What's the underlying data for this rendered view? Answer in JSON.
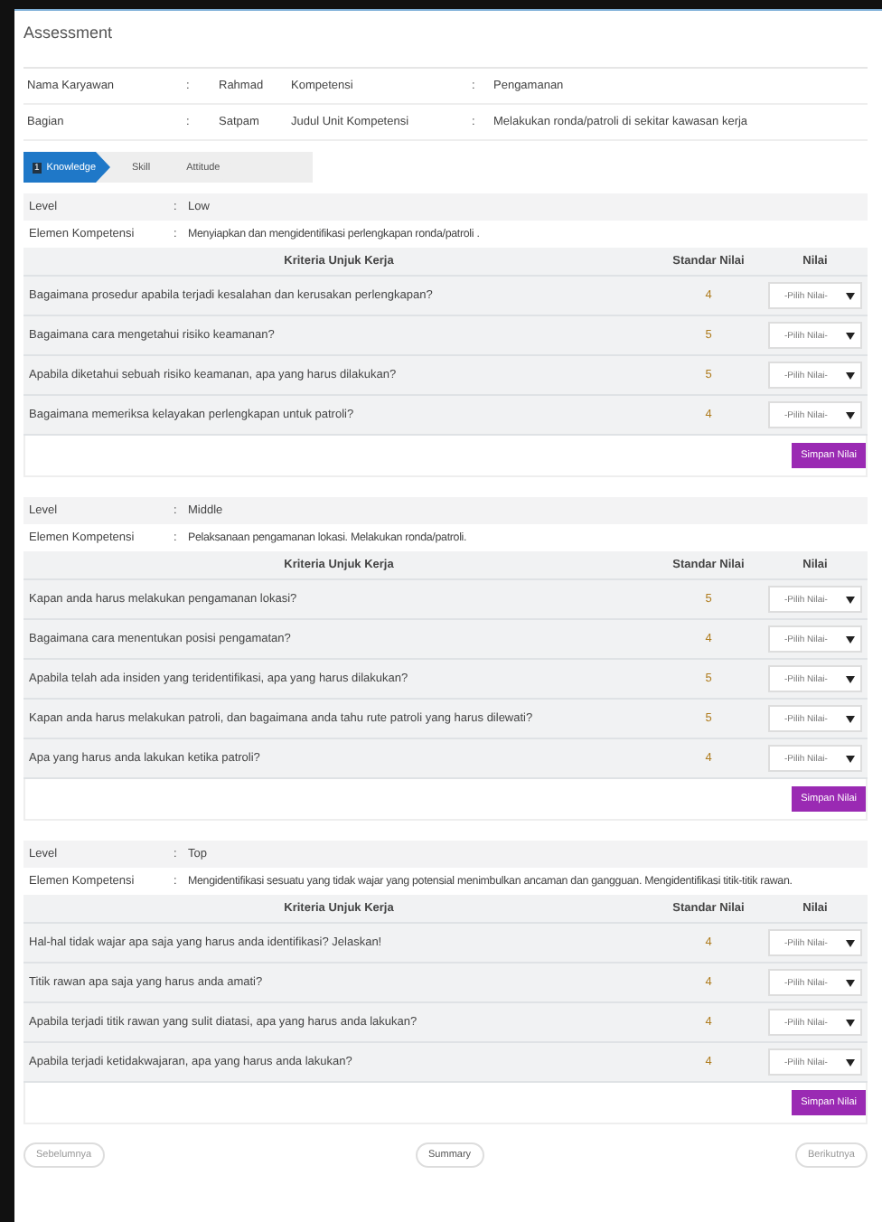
{
  "title": "Assessment",
  "info": [
    {
      "label": "Nama Karyawan",
      "colon": ":",
      "value": "Rahmad",
      "colon2": ":",
      "label2": "Kompetensi",
      "value2": "Pengamanan"
    },
    {
      "label": "Bagian",
      "colon": ":",
      "value": "Satpam",
      "colon2": ":",
      "label2": "Judul Unit Kompetensi",
      "value2": "Melakukan ronda/patroli di sekitar kawasan kerja"
    }
  ],
  "steps": [
    {
      "number": "1",
      "label": "Knowledge",
      "selected": true
    },
    {
      "label": "Skill",
      "selected": false
    },
    {
      "label": "Attitude",
      "selected": false
    }
  ],
  "sections": [
    {
      "level_label": "Level",
      "level_colon": ":",
      "level": "Low",
      "element_label": "Elemen Kompetensi",
      "element_colon": ":",
      "element": "Menyiapkan dan mengidentifikasi perlengkapan ronda/patroli .",
      "columns": [
        "Kriteria Unjuk Kerja",
        "Standar Nilai",
        "Nilai"
      ],
      "rows": [
        {
          "question": "Bagaimana prosedur apabila terjadi kesalahan dan kerusakan perlengkapan?",
          "standard": "4",
          "placeholder": "-Pilih Nilai-"
        },
        {
          "question": "Bagaimana cara mengetahui risiko keamanan?",
          "standard": "5",
          "placeholder": "-Pilih Nilai-"
        },
        {
          "question": "Apabila diketahui sebuah risiko keamanan, apa yang harus dilakukan?",
          "standard": "5",
          "placeholder": "-Pilih Nilai-"
        },
        {
          "question": "Bagaimana memeriksa kelayakan perlengkapan untuk patroli?",
          "standard": "4",
          "placeholder": "-Pilih Nilai-"
        }
      ],
      "save": "Simpan Nilai"
    },
    {
      "level_label": "Level",
      "level_colon": ":",
      "level": "Middle",
      "element_label": "Elemen Kompetensi",
      "element_colon": ":",
      "element": "Pelaksanaan pengamanan lokasi. Melakukan ronda/patroli.",
      "columns": [
        "Kriteria Unjuk Kerja",
        "Standar Nilai",
        "Nilai"
      ],
      "rows": [
        {
          "question": "Kapan anda harus melakukan pengamanan lokasi?",
          "standard": "5",
          "placeholder": "-Pilih Nilai-"
        },
        {
          "question": "Bagaimana cara menentukan posisi pengamatan?",
          "standard": "4",
          "placeholder": "-Pilih Nilai-"
        },
        {
          "question": "Apabila telah ada insiden yang teridentifikasi, apa yang harus dilakukan?",
          "standard": "5",
          "placeholder": "-Pilih Nilai-"
        },
        {
          "question": "Kapan anda harus melakukan patroli, dan bagaimana anda tahu rute patroli yang harus dilewati?",
          "standard": "5",
          "placeholder": "-Pilih Nilai-"
        },
        {
          "question": "Apa yang harus anda lakukan ketika patroli?",
          "standard": "4",
          "placeholder": "-Pilih Nilai-"
        }
      ],
      "save": "Simpan Nilai"
    },
    {
      "level_label": "Level",
      "level_colon": ":",
      "level": "Top",
      "element_label": "Elemen Kompetensi",
      "element_colon": ":",
      "element": "Mengidentifikasi sesuatu yang tidak wajar yang potensial menimbulkan ancaman dan gangguan. Mengidentifikasi titik-titik rawan.",
      "columns": [
        "Kriteria Unjuk Kerja",
        "Standar Nilai",
        "Nilai"
      ],
      "rows": [
        {
          "question": "Hal-hal tidak wajar apa saja yang harus anda identifikasi? Jelaskan!",
          "standard": "4",
          "placeholder": "-Pilih Nilai-"
        },
        {
          "question": "Titik rawan apa saja yang harus anda amati?",
          "standard": "4",
          "placeholder": "-Pilih Nilai-"
        },
        {
          "question": "Apabila terjadi titik rawan yang sulit diatasi, apa yang harus anda lakukan?",
          "standard": "4",
          "placeholder": "-Pilih Nilai-"
        },
        {
          "question": "Apabila terjadi ketidakwajaran, apa yang harus anda lakukan?",
          "standard": "4",
          "placeholder": "-Pilih Nilai-"
        }
      ],
      "save": "Simpan Nilai"
    }
  ],
  "footer": {
    "previous": "Sebelumnya",
    "summary": "Summary",
    "next": "Berikutnya"
  }
}
